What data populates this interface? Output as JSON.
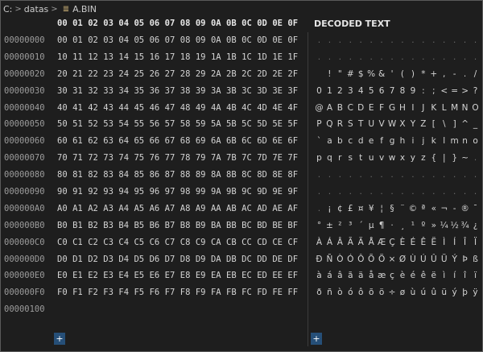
{
  "breadcrumb": {
    "drive": "C:",
    "folder": "datas",
    "file": "A.BIN"
  },
  "hex_header": [
    "00",
    "01",
    "02",
    "03",
    "04",
    "05",
    "06",
    "07",
    "08",
    "09",
    "0A",
    "0B",
    "0C",
    "0D",
    "0E",
    "0F"
  ],
  "decoded_title": "DECODED TEXT",
  "rows": [
    {
      "addr": "00000000",
      "hex": [
        "00",
        "01",
        "02",
        "03",
        "04",
        "05",
        "06",
        "07",
        "08",
        "09",
        "0A",
        "0B",
        "0C",
        "0D",
        "0E",
        "0F"
      ],
      "dec": [
        ".",
        ".",
        ".",
        ".",
        ".",
        ".",
        ".",
        ".",
        ".",
        ".",
        ".",
        ".",
        ".",
        ".",
        ".",
        "."
      ]
    },
    {
      "addr": "00000010",
      "hex": [
        "10",
        "11",
        "12",
        "13",
        "14",
        "15",
        "16",
        "17",
        "18",
        "19",
        "1A",
        "1B",
        "1C",
        "1D",
        "1E",
        "1F"
      ],
      "dec": [
        ".",
        ".",
        ".",
        ".",
        ".",
        ".",
        ".",
        ".",
        ".",
        ".",
        ".",
        ".",
        ".",
        ".",
        ".",
        "."
      ]
    },
    {
      "addr": "00000020",
      "hex": [
        "20",
        "21",
        "22",
        "23",
        "24",
        "25",
        "26",
        "27",
        "28",
        "29",
        "2A",
        "2B",
        "2C",
        "2D",
        "2E",
        "2F"
      ],
      "dec": [
        " ",
        "!",
        "\"",
        "#",
        "$",
        "%",
        "&",
        "'",
        "(",
        ")",
        "*",
        "+",
        ",",
        "-",
        ".",
        "/"
      ]
    },
    {
      "addr": "00000030",
      "hex": [
        "30",
        "31",
        "32",
        "33",
        "34",
        "35",
        "36",
        "37",
        "38",
        "39",
        "3A",
        "3B",
        "3C",
        "3D",
        "3E",
        "3F"
      ],
      "dec": [
        "0",
        "1",
        "2",
        "3",
        "4",
        "5",
        "6",
        "7",
        "8",
        "9",
        ":",
        ";",
        "<",
        "=",
        ">",
        "?"
      ]
    },
    {
      "addr": "00000040",
      "hex": [
        "40",
        "41",
        "42",
        "43",
        "44",
        "45",
        "46",
        "47",
        "48",
        "49",
        "4A",
        "4B",
        "4C",
        "4D",
        "4E",
        "4F"
      ],
      "dec": [
        "@",
        "A",
        "B",
        "C",
        "D",
        "E",
        "F",
        "G",
        "H",
        "I",
        "J",
        "K",
        "L",
        "M",
        "N",
        "O"
      ]
    },
    {
      "addr": "00000050",
      "hex": [
        "50",
        "51",
        "52",
        "53",
        "54",
        "55",
        "56",
        "57",
        "58",
        "59",
        "5A",
        "5B",
        "5C",
        "5D",
        "5E",
        "5F"
      ],
      "dec": [
        "P",
        "Q",
        "R",
        "S",
        "T",
        "U",
        "V",
        "W",
        "X",
        "Y",
        "Z",
        "[",
        "\\",
        "]",
        "^",
        "_"
      ]
    },
    {
      "addr": "00000060",
      "hex": [
        "60",
        "61",
        "62",
        "63",
        "64",
        "65",
        "66",
        "67",
        "68",
        "69",
        "6A",
        "6B",
        "6C",
        "6D",
        "6E",
        "6F"
      ],
      "dec": [
        "`",
        "a",
        "b",
        "c",
        "d",
        "e",
        "f",
        "g",
        "h",
        "i",
        "j",
        "k",
        "l",
        "m",
        "n",
        "o"
      ]
    },
    {
      "addr": "00000070",
      "hex": [
        "70",
        "71",
        "72",
        "73",
        "74",
        "75",
        "76",
        "77",
        "78",
        "79",
        "7A",
        "7B",
        "7C",
        "7D",
        "7E",
        "7F"
      ],
      "dec": [
        "p",
        "q",
        "r",
        "s",
        "t",
        "u",
        "v",
        "w",
        "x",
        "y",
        "z",
        "{",
        "|",
        "}",
        "~",
        "."
      ]
    },
    {
      "addr": "00000080",
      "hex": [
        "80",
        "81",
        "82",
        "83",
        "84",
        "85",
        "86",
        "87",
        "88",
        "89",
        "8A",
        "8B",
        "8C",
        "8D",
        "8E",
        "8F"
      ],
      "dec": [
        ".",
        ".",
        ".",
        ".",
        ".",
        ".",
        ".",
        ".",
        ".",
        ".",
        ".",
        ".",
        ".",
        ".",
        ".",
        "."
      ]
    },
    {
      "addr": "00000090",
      "hex": [
        "90",
        "91",
        "92",
        "93",
        "94",
        "95",
        "96",
        "97",
        "98",
        "99",
        "9A",
        "9B",
        "9C",
        "9D",
        "9E",
        "9F"
      ],
      "dec": [
        ".",
        ".",
        ".",
        ".",
        ".",
        ".",
        ".",
        ".",
        ".",
        ".",
        ".",
        ".",
        ".",
        ".",
        ".",
        "."
      ]
    },
    {
      "addr": "000000A0",
      "hex": [
        "A0",
        "A1",
        "A2",
        "A3",
        "A4",
        "A5",
        "A6",
        "A7",
        "A8",
        "A9",
        "AA",
        "AB",
        "AC",
        "AD",
        "AE",
        "AF"
      ],
      "dec": [
        ".",
        "¡",
        "¢",
        "£",
        "¤",
        "¥",
        "¦",
        "§",
        "¨",
        "©",
        "ª",
        "«",
        "¬",
        "-",
        "®",
        "¯"
      ]
    },
    {
      "addr": "000000B0",
      "hex": [
        "B0",
        "B1",
        "B2",
        "B3",
        "B4",
        "B5",
        "B6",
        "B7",
        "B8",
        "B9",
        "BA",
        "BB",
        "BC",
        "BD",
        "BE",
        "BF"
      ],
      "dec": [
        "°",
        "±",
        "²",
        "³",
        "´",
        "µ",
        "¶",
        "·",
        "¸",
        "¹",
        "º",
        "»",
        "¼",
        "½",
        "¾",
        "¿"
      ]
    },
    {
      "addr": "000000C0",
      "hex": [
        "C0",
        "C1",
        "C2",
        "C3",
        "C4",
        "C5",
        "C6",
        "C7",
        "C8",
        "C9",
        "CA",
        "CB",
        "CC",
        "CD",
        "CE",
        "CF"
      ],
      "dec": [
        "À",
        "Á",
        "Â",
        "Ã",
        "Ä",
        "Å",
        "Æ",
        "Ç",
        "È",
        "É",
        "Ê",
        "Ë",
        "Ì",
        "Í",
        "Î",
        "Ï"
      ]
    },
    {
      "addr": "000000D0",
      "hex": [
        "D0",
        "D1",
        "D2",
        "D3",
        "D4",
        "D5",
        "D6",
        "D7",
        "D8",
        "D9",
        "DA",
        "DB",
        "DC",
        "DD",
        "DE",
        "DF"
      ],
      "dec": [
        "Ð",
        "Ñ",
        "Ò",
        "Ó",
        "Ô",
        "Õ",
        "Ö",
        "×",
        "Ø",
        "Ù",
        "Ú",
        "Û",
        "Ü",
        "Ý",
        "Þ",
        "ß"
      ]
    },
    {
      "addr": "000000E0",
      "hex": [
        "E0",
        "E1",
        "E2",
        "E3",
        "E4",
        "E5",
        "E6",
        "E7",
        "E8",
        "E9",
        "EA",
        "EB",
        "EC",
        "ED",
        "EE",
        "EF"
      ],
      "dec": [
        "à",
        "á",
        "â",
        "ã",
        "ä",
        "å",
        "æ",
        "ç",
        "è",
        "é",
        "ê",
        "ë",
        "ì",
        "í",
        "î",
        "ï"
      ]
    },
    {
      "addr": "000000F0",
      "hex": [
        "F0",
        "F1",
        "F2",
        "F3",
        "F4",
        "F5",
        "F6",
        "F7",
        "F8",
        "F9",
        "FA",
        "FB",
        "FC",
        "FD",
        "FE",
        "FF"
      ],
      "dec": [
        "ð",
        "ñ",
        "ò",
        "ó",
        "ô",
        "õ",
        "ö",
        "÷",
        "ø",
        "ù",
        "ú",
        "û",
        "ü",
        "ý",
        "þ",
        "ÿ"
      ]
    },
    {
      "addr": "00000100",
      "hex": [],
      "dec": []
    }
  ],
  "add_button_label": "+"
}
